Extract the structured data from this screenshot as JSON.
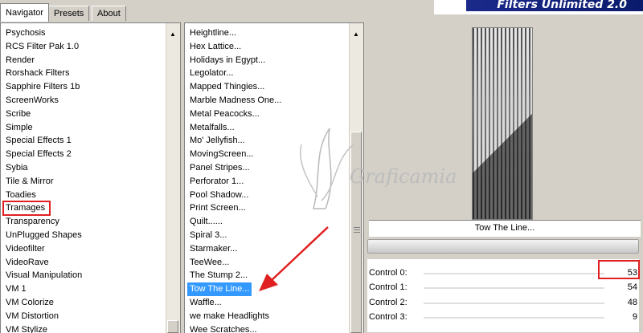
{
  "tabs": [
    {
      "label": "Navigator",
      "active": true
    },
    {
      "label": "Presets",
      "active": false
    },
    {
      "label": "About",
      "active": false
    }
  ],
  "brand": "Filters Unlimited 2.0",
  "categories": [
    "Psychosis",
    "RCS Filter Pak 1.0",
    "Render",
    "Rorshack Filters",
    "Sapphire Filters 1b",
    "ScreenWorks",
    "Scribe",
    "Simple",
    "Special Effects 1",
    "Special Effects 2",
    "Sybia",
    "Tile & Mirror",
    "Toadies",
    "Tramages",
    "Transparency",
    "UnPlugged Shapes",
    "Videofilter",
    "VideoRave",
    "Visual Manipulation",
    "VM 1",
    "VM Colorize",
    "VM Distortion",
    "VM Stylize"
  ],
  "highlighted_category": "Tramages",
  "filters": [
    "Heightline...",
    "Hex Lattice...",
    "Holidays in Egypt...",
    "Legolator...",
    "Mapped Thingies...",
    "Marble Madness One...",
    "Metal Peacocks...",
    "Metalfalls...",
    "Mo' Jellyfish...",
    "MovingScreen...",
    "Panel Stripes...",
    "Perforator 1...",
    "Pool Shadow...",
    "Print Screen...",
    "Quilt......",
    "Spiral 3...",
    "Starmaker...",
    "TeeWee...",
    "The Stump 2...",
    "Tow The Line...",
    "Waffle...",
    "we make Headlights",
    "Wee Scratches..."
  ],
  "selected_filter": "Tow The Line...",
  "preview": {
    "filter_name": "Tow The Line..."
  },
  "controls": [
    {
      "label": "Control 0:",
      "value": "53"
    },
    {
      "label": "Control 1:",
      "value": "54"
    },
    {
      "label": "Control 2:",
      "value": "48"
    },
    {
      "label": "Control 3:",
      "value": "9"
    }
  ],
  "watermark": "Graficamia",
  "colors": {
    "selection": "#3399ff",
    "annotation": "#e02020",
    "brand_bar": "#1b2a8a"
  }
}
